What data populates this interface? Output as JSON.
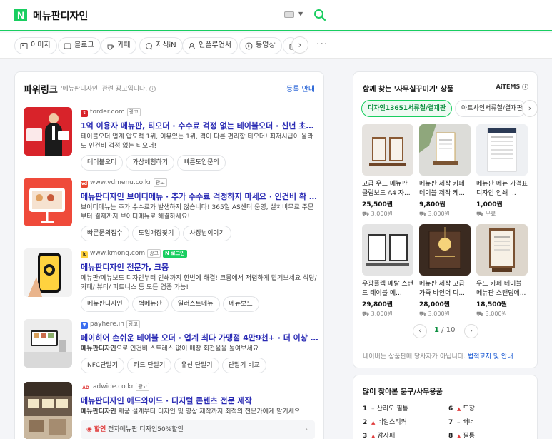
{
  "header": {
    "logo": "N",
    "query": "메뉴판디자인"
  },
  "tabs": [
    "이미지",
    "블로그",
    "카페",
    "지식iN",
    "인플루언서",
    "동영상",
    "쇼"
  ],
  "tab_more": "···",
  "powerlink": {
    "title": "파워링크",
    "subtitle": "'메뉴판디자인' 관련 광고입니다.",
    "register": "등록 안내",
    "ad_label": "광고",
    "ads": [
      {
        "source": "torder.com",
        "title": "1억 이용자 메뉴판, 티오더 · 수수료 걱정 없는 테이블오더 · 신년 초특급 혜택",
        "desc": "테이블오더 업계 압도적 1위, 이유있는 1위, 격이 다른 편리함 티오더! 최저시급이 올라도 인건비 걱정 없는 티오더!",
        "chips": [
          "테이블오더",
          "가상체험하기",
          "빠른도입문의"
        ]
      },
      {
        "source": "www.vdmenu.co.kr",
        "title": "메뉴판디자인 브이디메뉴 · 추가 수수료 걱정하지 마세요 · 인건비 확 낮춰주...",
        "desc": "브이디메뉴는 추가 수수료가 발생하지 않습니다! 365일 AS센터 운영, 설치비무료 주문부터 결제까지 브이디메뉴로 해결하세요!",
        "chips": [
          "빠른문의접수",
          "도입매장찾기",
          "사장님이야기"
        ]
      },
      {
        "source": "www.kmong.com",
        "extra_badge": "N 로그인",
        "title": "메뉴판디자인 전문가, 크몽",
        "desc": "메뉴판/메뉴보드 디자인부터 인쇄까지 한번에 해결! 크몽에서 저렴하게 맡겨보세요 식당/카페/ 뷰티/ 피트니스 등 모든 업종 가능!",
        "chips": [
          "메뉴판디자인",
          "벽메뉴판",
          "일러스트메뉴",
          "메뉴보드"
        ]
      },
      {
        "source": "payhere.in",
        "title": "페이히어 손쉬운 테이블 오더 · 업계 최다 가맹점 4만9천+ · 더 이상 인건비 ...",
        "desc_bold": "메뉴판디자인",
        "desc": "으로 인건비 스트레스 없이 매장 회전율을 높여보세요",
        "chips": [
          "NFC단말기",
          "카드 단말기",
          "유선 단말기",
          "단말기 비교"
        ]
      },
      {
        "source": "adwide.co.kr",
        "title": "메뉴판디자인 애드와이드 · 디지털 콘텐츠 전문 제작",
        "desc_bold": "메뉴판디자인",
        "desc": " 제품 설계부터 디자인 및 영상 제작까지 최적의 전문가에게 맡기세요",
        "promo_tag": "할인",
        "promo": "전자메뉴판 디자인50%할인"
      }
    ]
  },
  "shopping": {
    "title": "함께 찾는 '사무실꾸미기' 상품",
    "brand": "AiTEMS",
    "pills": [
      "디자인13651서류철/결재판",
      "아트사인서류철/결재판"
    ],
    "products": [
      {
        "name": "고급 우드 메뉴판 클립보드 A4 자...",
        "price": "25,500원",
        "ship": "3,000원"
      },
      {
        "name": "메뉴판 제작 카페 테이블 제작 케...",
        "price": "9,800원",
        "ship": "3,000원"
      },
      {
        "name": "메뉴판 메뉴 가격표 디자인 인쇄 ...",
        "price": "1,000원",
        "ship": "무료"
      },
      {
        "name": "우광플렉 메탈 스탠드 테이블 메...",
        "price": "29,800원",
        "ship": "3,000원"
      },
      {
        "name": "메뉴판 제작 고급 가죽 바인더 디...",
        "price": "28,000원",
        "ship": "3,000원"
      },
      {
        "name": "우드 카페 테이블 메뉴판 스탠딩메...",
        "price": "18,500원",
        "ship": "3,000원"
      }
    ],
    "page": "1",
    "total": "/ 10",
    "footer": "네이버는 상품판매 당사자가 아닙니다.",
    "footer_link": "법적고지 및 안내"
  },
  "popular": {
    "title": "많이 찾아본 문구/사무용품",
    "items": [
      {
        "rank": "1",
        "trend": "–",
        "name": "산리오 필통"
      },
      {
        "rank": "2",
        "trend": "▲",
        "name": "네임스티커"
      },
      {
        "rank": "3",
        "trend": "▲",
        "name": "감사패"
      },
      {
        "rank": "6",
        "trend": "▲",
        "name": "도장"
      },
      {
        "rank": "7",
        "trend": "–",
        "name": "배너"
      },
      {
        "rank": "8",
        "trend": "▲",
        "name": "필통"
      }
    ]
  },
  "colors": {
    "brand_green": "#19ce60",
    "link_blue": "#2a2bb4",
    "price_red": "#e03c3c"
  }
}
